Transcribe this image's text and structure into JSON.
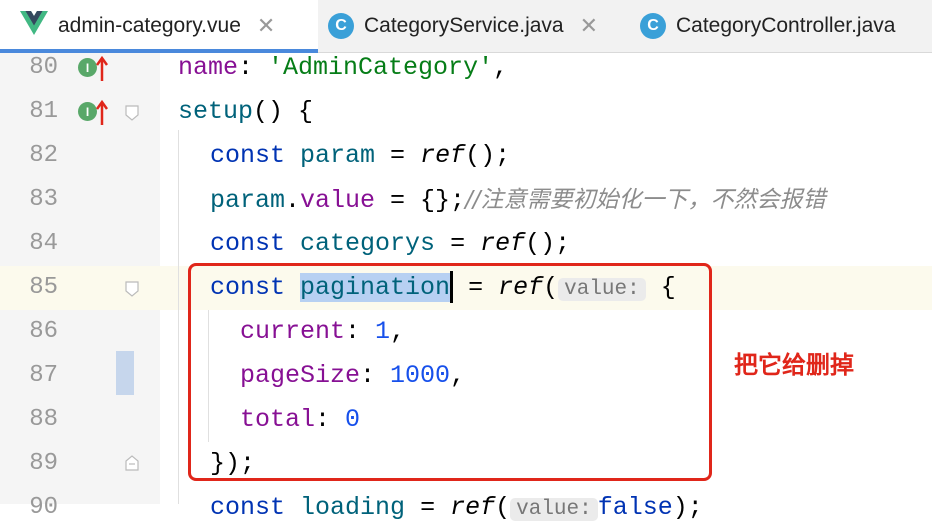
{
  "tabs": [
    {
      "label": "admin-category.vue",
      "icon": "vue-icon",
      "active": true
    },
    {
      "label": "CategoryService.java",
      "icon": "class-c-icon",
      "active": false
    },
    {
      "label": "CategoryController.java",
      "icon": "class-c-icon",
      "active": false
    }
  ],
  "close_glyph": "✕",
  "lines": [
    {
      "number": "80"
    },
    {
      "number": "81"
    },
    {
      "number": "82"
    },
    {
      "number": "83"
    },
    {
      "number": "84"
    },
    {
      "number": "85"
    },
    {
      "number": "86"
    },
    {
      "number": "87"
    },
    {
      "number": "88"
    },
    {
      "number": "89"
    },
    {
      "number": "90"
    }
  ],
  "code": {
    "l80": {
      "key": "name",
      "colon": ": ",
      "value": "'AdminCategory'",
      "tail": ","
    },
    "l81": {
      "fn": "setup",
      "tail": "() {"
    },
    "l82": {
      "kw": "const",
      "name": "param",
      "eq": " = ",
      "call": "ref",
      "tail": "();"
    },
    "l83": {
      "obj": "param",
      "dot": ".",
      "prop": "value",
      "mid": " = {};",
      "comment": "//注意需要初始化一下，不然会报错"
    },
    "l84": {
      "kw": "const",
      "name": "categorys",
      "eq": " = ",
      "call": "ref",
      "tail": "();"
    },
    "l85": {
      "kw": "const",
      "name": "pagination",
      "eq": " = ",
      "call": "ref",
      "paren": "(",
      "hint": "value:",
      "tail": " {"
    },
    "l86": {
      "key": "current",
      "colon": ": ",
      "value": "1",
      "tail": ","
    },
    "l87": {
      "key": "pageSize",
      "colon": ": ",
      "value": "1000",
      "tail": ","
    },
    "l88": {
      "key": "total",
      "colon": ": ",
      "value": "0"
    },
    "l89": {
      "tail": "});"
    },
    "l90": {
      "kw": "const",
      "name": "loading",
      "eq": " = ",
      "call": "ref",
      "paren": "(",
      "hint": "value:",
      "value": "false",
      "tail": ");"
    }
  },
  "gutter_marks": {
    "implements": "I"
  },
  "annotation": "把它给删掉",
  "colors": {
    "highlight_box": "#e0261a",
    "keyword": "#0033b3",
    "property": "#871094",
    "string": "#067d17",
    "number": "#1750eb"
  }
}
